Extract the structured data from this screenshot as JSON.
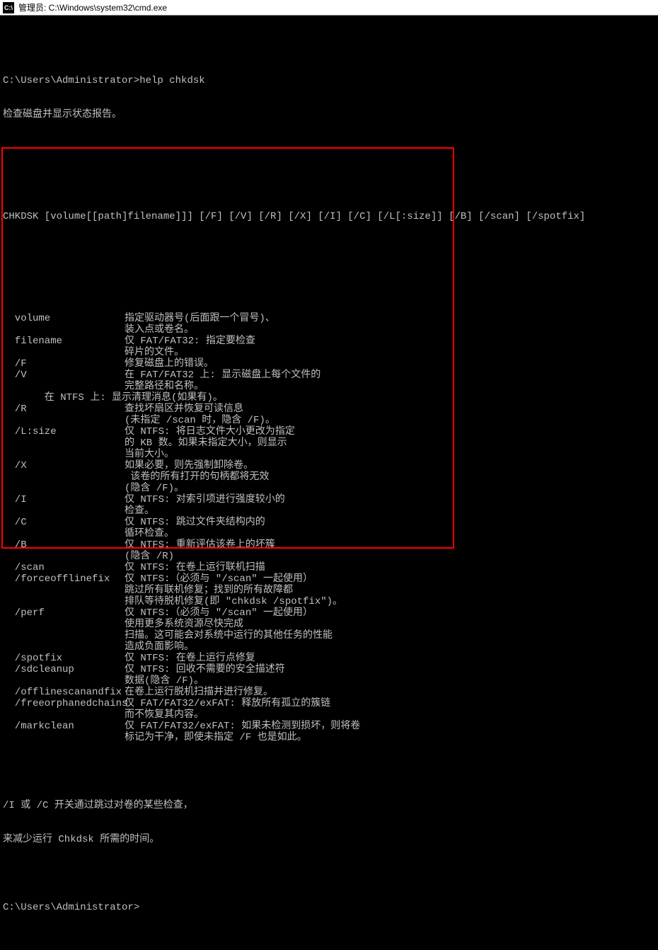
{
  "title": "管理员: C:\\Windows\\system32\\cmd.exe",
  "prompt1": "C:\\Users\\Administrator>help chkdsk",
  "summary": "检查磁盘并显示状态报告。",
  "syntax": "CHKDSK [volume[[path]filename]]] [/F] [/V] [/R] [/X] [/I] [/C] [/L[:size]] [/B] [/scan] [/spotfix]",
  "options": [
    {
      "name": "  volume",
      "desc": [
        "指定驱动器号(后面跟一个冒号)、",
        "装入点或卷名。"
      ]
    },
    {
      "name": "  filename",
      "desc": [
        "仅 FAT/FAT32: 指定要检查",
        "碎片的文件。"
      ]
    },
    {
      "name": "  /F",
      "desc": [
        "修复磁盘上的错误。"
      ]
    },
    {
      "name": "  /V",
      "desc": [
        "在 FAT/FAT32 上: 显示磁盘上每个文件的",
        "完整路径和名称。"
      ]
    },
    {
      "name": "",
      "desc": [
        "       在 NTFS 上: 显示清理消息(如果有)。"
      ],
      "special": true
    },
    {
      "name": "  /R",
      "desc": [
        "查找坏扇区并恢复可读信息",
        "(未指定 /scan 时，隐含 /F)。"
      ]
    },
    {
      "name": "  /L:size",
      "desc": [
        "仅 NTFS: 将日志文件大小更改为指定",
        "的 KB 数。如果未指定大小，则显示",
        "当前大小。"
      ]
    },
    {
      "name": "  /X",
      "desc": [
        "如果必要，则先强制卸除卷。",
        " 该卷的所有打开的句柄都将无效",
        "(隐含 /F)。"
      ]
    },
    {
      "name": "  /I",
      "desc": [
        "仅 NTFS: 对索引项进行强度较小的",
        "检查。"
      ]
    },
    {
      "name": "  /C",
      "desc": [
        "仅 NTFS: 跳过文件夹结构内的",
        "循环检查。"
      ]
    },
    {
      "name": "  /B",
      "desc": [
        "仅 NTFS: 重新评估该卷上的坏簇",
        "(隐含 /R)"
      ]
    },
    {
      "name": "  /scan",
      "desc": [
        "仅 NTFS: 在卷上运行联机扫描"
      ]
    },
    {
      "name": "  /forceofflinefix",
      "desc": [
        "仅 NTFS:（必须与 \"/scan\" 一起使用）",
        "跳过所有联机修复；找到的所有故障都",
        "排队等待脱机修复(即 \"chkdsk /spotfix\")。"
      ]
    },
    {
      "name": "  /perf",
      "desc": [
        "仅 NTFS:（必须与 \"/scan\" 一起使用）",
        "使用更多系统资源尽快完成",
        "扫描。这可能会对系统中运行的其他任务的性能",
        "造成负面影响。"
      ]
    },
    {
      "name": "  /spotfix",
      "desc": [
        "仅 NTFS: 在卷上运行点修复"
      ]
    },
    {
      "name": "  /sdcleanup",
      "desc": [
        "仅 NTFS: 回收不需要的安全描述符",
        "数据(隐含 /F)。"
      ]
    },
    {
      "name": "  /offlinescanandfix",
      "desc": [
        "在卷上运行脱机扫描并进行修复。"
      ]
    },
    {
      "name": "  /freeorphanedchains",
      "desc": [
        "仅 FAT/FAT32/exFAT: 释放所有孤立的簇链",
        "而不恢复其内容。"
      ]
    },
    {
      "name": "  /markclean",
      "desc": [
        "仅 FAT/FAT32/exFAT: 如果未检测到损坏，则将卷",
        "标记为干净，即使未指定 /F 也是如此。"
      ]
    }
  ],
  "footer1": "/I 或 /C 开关通过跳过对卷的某些检查，",
  "footer2": "来减少运行 Chkdsk 所需的时间。",
  "prompt2": "C:\\Users\\Administrator>"
}
